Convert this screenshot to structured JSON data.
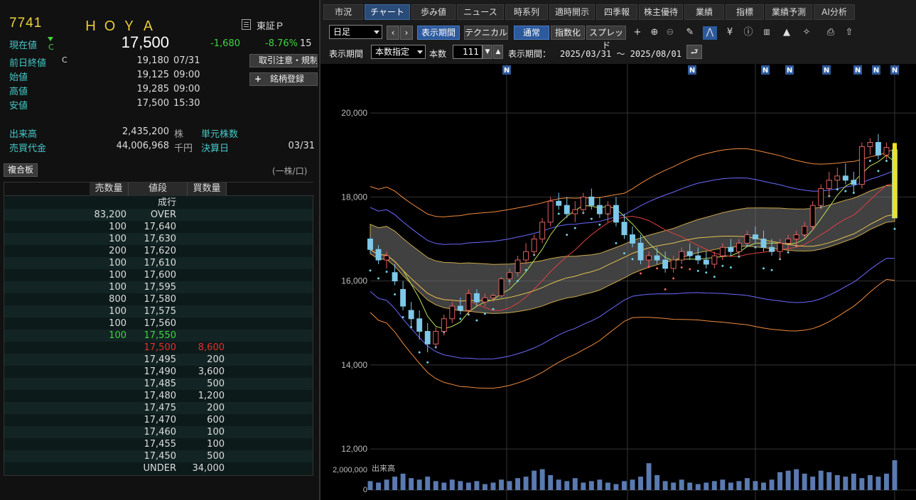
{
  "stock": {
    "code": "7741",
    "name": "ＨＯＹＡ",
    "market": "東証Ｐ",
    "price_label": "現在値",
    "price": "17,500",
    "price_flag": "C",
    "change": "-1,680",
    "change_pct": "-8.76%",
    "change_time": "15",
    "prev_close_label": "前日終値",
    "prev_close_flag": "C",
    "prev_close": "19,180",
    "prev_close_date": "07/31",
    "open_label": "始値",
    "open": "19,125",
    "open_time": "09:00",
    "high_label": "高値",
    "high": "19,285",
    "high_time": "09:00",
    "low_label": "安値",
    "low": "17,500",
    "low_time": "15:30",
    "volume_label": "出来高",
    "volume": "2,435,200",
    "volume_unit": "株",
    "unit_shares_label": "単元株数",
    "turnover_label": "売買代金",
    "turnover": "44,006,968",
    "turnover_unit": "千円",
    "settlement_label": "決算日",
    "settlement": "03/31",
    "btn_notice": "取引注意・規制",
    "btn_register": "銘柄登録",
    "btn_board": "複合板",
    "board_unit": "(一株/口)"
  },
  "board": {
    "headers": [
      "売数量",
      "値段",
      "買数量"
    ],
    "market_order": "成行",
    "rows": [
      {
        "sell": "83,200",
        "price": "OVER",
        "buy": ""
      },
      {
        "sell": "100",
        "price": "17,640",
        "buy": ""
      },
      {
        "sell": "100",
        "price": "17,630",
        "buy": ""
      },
      {
        "sell": "200",
        "price": "17,620",
        "buy": ""
      },
      {
        "sell": "100",
        "price": "17,610",
        "buy": ""
      },
      {
        "sell": "100",
        "price": "17,600",
        "buy": ""
      },
      {
        "sell": "100",
        "price": "17,595",
        "buy": ""
      },
      {
        "sell": "800",
        "price": "17,580",
        "buy": ""
      },
      {
        "sell": "100",
        "price": "17,575",
        "buy": ""
      },
      {
        "sell": "100",
        "price": "17,560",
        "buy": ""
      },
      {
        "sell": "100",
        "price": "17,550",
        "buy": "",
        "color": "#3fd53f"
      },
      {
        "sell": "",
        "price": "17,500",
        "buy": "8,600",
        "color": "#e03030"
      },
      {
        "sell": "",
        "price": "17,495",
        "buy": "200"
      },
      {
        "sell": "",
        "price": "17,490",
        "buy": "3,600"
      },
      {
        "sell": "",
        "price": "17,485",
        "buy": "500"
      },
      {
        "sell": "",
        "price": "17,480",
        "buy": "1,200"
      },
      {
        "sell": "",
        "price": "17,475",
        "buy": "200"
      },
      {
        "sell": "",
        "price": "17,470",
        "buy": "600"
      },
      {
        "sell": "",
        "price": "17,460",
        "buy": "100"
      },
      {
        "sell": "",
        "price": "17,455",
        "buy": "100"
      },
      {
        "sell": "",
        "price": "17,450",
        "buy": "500"
      },
      {
        "sell": "",
        "price": "UNDER",
        "buy": "34,000"
      }
    ]
  },
  "tabs": [
    "市況",
    "チャート",
    "歩み値",
    "ニュース",
    "時系列",
    "適時開示",
    "四季報",
    "株主優待",
    "業績",
    "指標",
    "業績予測",
    "AI分析"
  ],
  "active_tab": "チャート",
  "toolbar": {
    "period_select": "日足",
    "btn_display_period": "表示期間",
    "btn_technical": "テクニカル",
    "btn_normal": "通常",
    "btn_index": "指数化",
    "btn_spread": "スプレッド",
    "period_label": "表示期間",
    "period_mode": "本数指定",
    "bars_label": "本数",
    "bars_value": "111",
    "period_text_label": "表示期間：",
    "period_range": "2025/03/31 〜 2025/08/01",
    "yen_icon": "¥"
  },
  "chart_data": {
    "type": "candlestick",
    "news_marker": "N",
    "volume_label": "出来高",
    "y_ticks": [
      "20,000",
      "18,000",
      "16,000",
      "14,000",
      "12,000"
    ],
    "vol_ticks": [
      "2,000,000",
      "0"
    ],
    "ylim": [
      11900,
      21000
    ],
    "candles": [
      [
        17000,
        17050,
        16650,
        16750
      ],
      [
        16750,
        16850,
        16400,
        16500
      ],
      [
        16500,
        16700,
        16300,
        16600
      ],
      [
        16200,
        16400,
        15900,
        16000
      ],
      [
        15800,
        16000,
        15300,
        15400
      ],
      [
        15300,
        15500,
        14900,
        15100
      ],
      [
        15100,
        15300,
        14600,
        14800
      ],
      [
        14800,
        15000,
        14300,
        14500
      ],
      [
        14500,
        14900,
        14400,
        14800
      ],
      [
        14800,
        15200,
        14700,
        15100
      ],
      [
        15100,
        15500,
        15000,
        15400
      ],
      [
        15400,
        15600,
        15200,
        15300
      ],
      [
        15300,
        15800,
        15200,
        15700
      ],
      [
        15700,
        15800,
        15400,
        15500
      ],
      [
        15500,
        15700,
        15400,
        15600
      ],
      [
        15600,
        15700,
        15500,
        15650
      ],
      [
        15650,
        16100,
        15600,
        16050
      ],
      [
        16050,
        16300,
        15900,
        16200
      ],
      [
        16200,
        16600,
        16100,
        16500
      ],
      [
        16500,
        16900,
        16400,
        16700
      ],
      [
        16700,
        17100,
        16600,
        17000
      ],
      [
        17000,
        17500,
        16900,
        17400
      ],
      [
        17400,
        18000,
        17300,
        17900
      ],
      [
        17900,
        18100,
        17700,
        17800
      ],
      [
        17800,
        18000,
        17500,
        17600
      ],
      [
        17600,
        17900,
        17400,
        17700
      ],
      [
        17700,
        18100,
        17600,
        18000
      ],
      [
        18000,
        18200,
        17700,
        17800
      ],
      [
        17800,
        18000,
        17500,
        17600
      ],
      [
        17600,
        17900,
        17400,
        17800
      ],
      [
        17800,
        18000,
        17300,
        17400
      ],
      [
        17400,
        17600,
        17000,
        17100
      ],
      [
        17100,
        17300,
        16800,
        16900
      ],
      [
        16900,
        17100,
        16400,
        16500
      ],
      [
        16500,
        16700,
        16300,
        16600
      ],
      [
        16600,
        16800,
        16400,
        16500
      ],
      [
        16500,
        16700,
        16200,
        16300
      ],
      [
        16300,
        16600,
        16200,
        16500
      ],
      [
        16500,
        16800,
        16400,
        16700
      ],
      [
        16700,
        16900,
        16500,
        16600
      ],
      [
        16600,
        16800,
        16400,
        16500
      ],
      [
        16500,
        16700,
        16300,
        16400
      ],
      [
        16400,
        16700,
        16300,
        16600
      ],
      [
        16600,
        16900,
        16500,
        16800
      ],
      [
        16800,
        17000,
        16600,
        16700
      ],
      [
        16700,
        17000,
        16600,
        16900
      ],
      [
        16900,
        17200,
        16800,
        17100
      ],
      [
        17100,
        17300,
        16900,
        17000
      ],
      [
        17000,
        17200,
        16700,
        16800
      ],
      [
        16800,
        17000,
        16600,
        16700
      ],
      [
        16700,
        17000,
        16500,
        16900
      ],
      [
        16900,
        17100,
        16700,
        17000
      ],
      [
        17000,
        17200,
        16800,
        17100
      ],
      [
        17100,
        17400,
        17000,
        17300
      ],
      [
        17300,
        17900,
        17200,
        17800
      ],
      [
        17800,
        18300,
        17700,
        18200
      ],
      [
        18200,
        18600,
        18000,
        18400
      ],
      [
        18400,
        18700,
        18200,
        18500
      ],
      [
        18500,
        18800,
        18300,
        18400
      ],
      [
        18400,
        18600,
        18100,
        18300
      ],
      [
        18300,
        19300,
        18200,
        19200
      ],
      [
        19200,
        19400,
        19000,
        19300
      ],
      [
        19300,
        19500,
        18900,
        19000
      ],
      [
        19000,
        19300,
        18900,
        19180
      ],
      [
        19125,
        19285,
        17500,
        17500
      ]
    ],
    "volumes": [
      0.6,
      0.5,
      0.7,
      0.9,
      1.1,
      0.8,
      0.7,
      0.9,
      0.6,
      0.5,
      0.7,
      0.6,
      0.5,
      0.6,
      0.4,
      0.5,
      0.7,
      0.6,
      0.8,
      0.9,
      1.3,
      1.4,
      1.0,
      0.7,
      0.6,
      0.8,
      0.5,
      0.6,
      0.7,
      0.5,
      0.4,
      0.6,
      0.7,
      0.9,
      1.8,
      1.0,
      0.6,
      0.5,
      0.7,
      0.5,
      0.4,
      0.5,
      0.6,
      0.7,
      0.5,
      0.6,
      0.8,
      0.6,
      0.5,
      0.7,
      1.2,
      1.3,
      1.4,
      1.1,
      0.9,
      1.3,
      1.2,
      1.0,
      0.9,
      1.1,
      0.8,
      1.0,
      0.9,
      1.1,
      2.0
    ]
  }
}
